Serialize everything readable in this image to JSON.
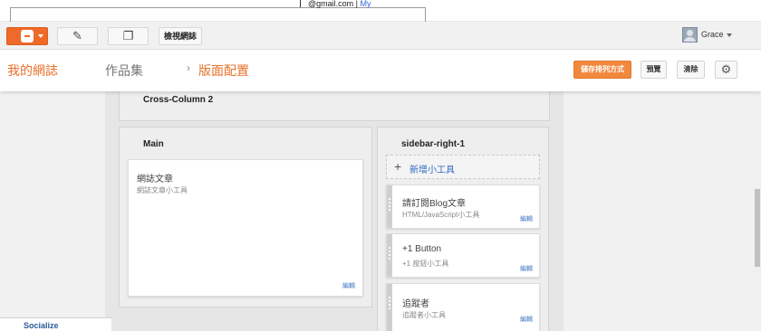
{
  "top_strip": {
    "account_email": "@gmail.com",
    "separator": "|",
    "my_link": "My"
  },
  "toolbar": {
    "pencil_icon": "✎",
    "pages_icon": "❐",
    "view_blog_label": "檢視網誌",
    "user_name": "Grace"
  },
  "header": {
    "crumb_home": "我的網誌",
    "crumb_blog": "作品集",
    "crumb_sep": "›",
    "crumb_page": "版面配置",
    "save_label": "儲存排列方式",
    "preview_label": "預覽",
    "clear_label": "清除",
    "gear_icon": "⚙"
  },
  "layout": {
    "cross_column_title": "Cross-Column 2",
    "main_title": "Main",
    "sidebar_title": "sidebar-right-1",
    "blog_posts_widget": {
      "title": "網誌文章",
      "subtitle": "網誌文章小工具",
      "edit_label": "編輯"
    },
    "add_widget": {
      "plus": "+",
      "label": "新增小工具"
    },
    "sidebar_widgets": [
      {
        "title": "請訂閱Blog文章",
        "subtitle": "HTML/JavaScript小工具",
        "edit_label": "編輯"
      },
      {
        "title": "+1 Button",
        "subtitle": "+1 按鈕小工具",
        "edit_label": "編輯"
      },
      {
        "title": "追蹤者",
        "subtitle": "追蹤者小工具",
        "edit_label": "編輯"
      }
    ]
  },
  "bottom": {
    "socialize_label": "Socialize"
  },
  "colors": {
    "accent_orange": "#ef6a28",
    "link_blue": "#3f77c4",
    "canvas_gray": "#e6e6e6"
  }
}
